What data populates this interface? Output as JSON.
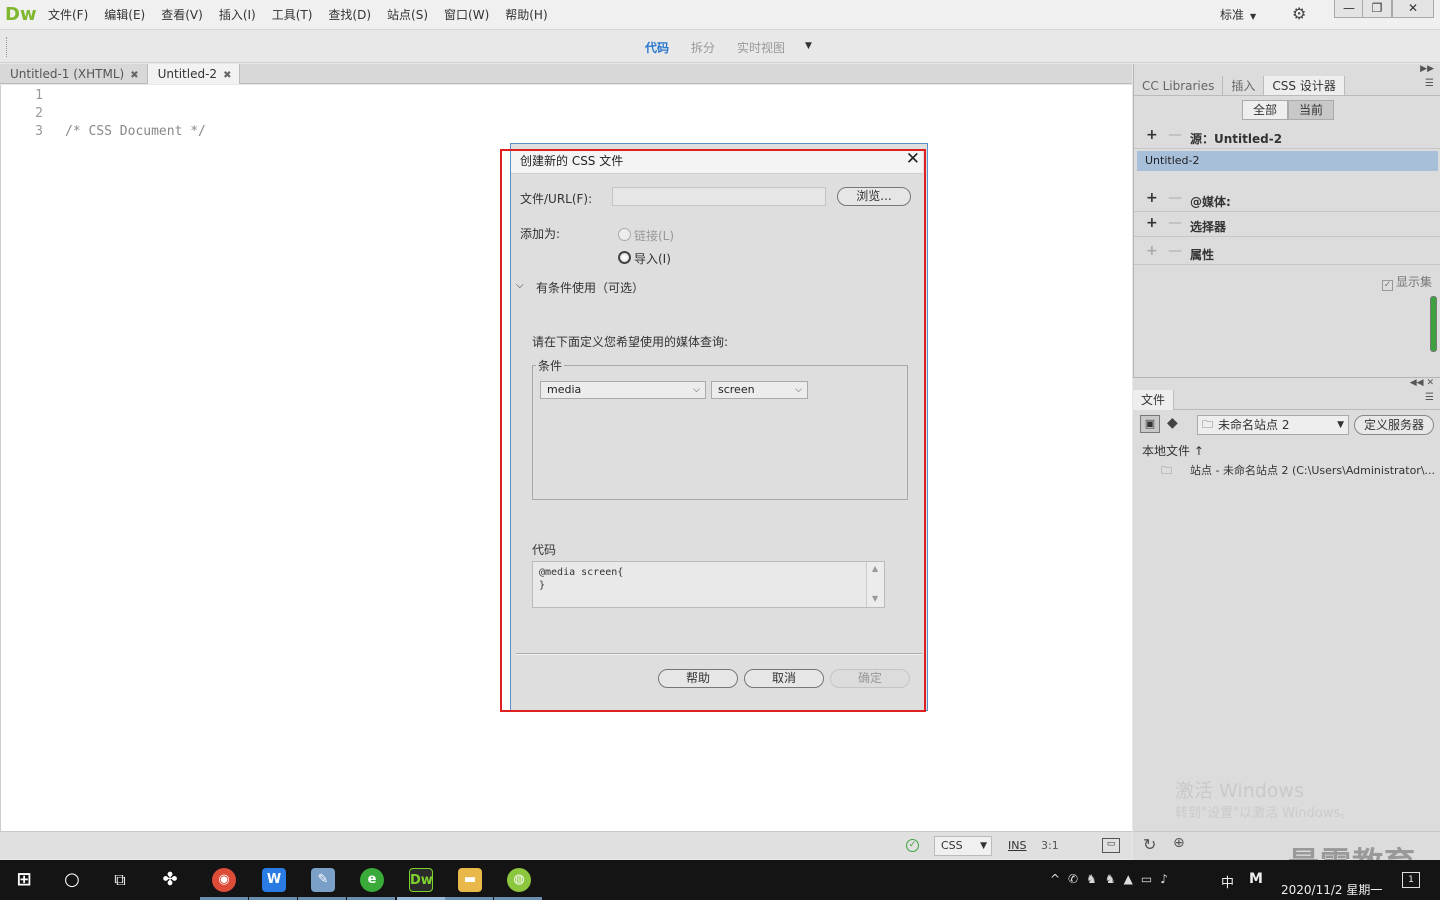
{
  "app": {
    "logo": "Dw",
    "menu": [
      "文件(F)",
      "编辑(E)",
      "查看(V)",
      "插入(I)",
      "工具(T)",
      "查找(D)",
      "站点(S)",
      "窗口(W)",
      "帮助(H)"
    ],
    "workspace": "标准",
    "window_controls": [
      "—",
      "❐",
      "✕"
    ]
  },
  "toolbar": {
    "view_tabs": [
      "代码",
      "拆分",
      "实时视图"
    ],
    "active_view": "代码"
  },
  "doc_tabs": [
    {
      "label": "Untitled-1 (XHTML)",
      "active": false
    },
    {
      "label": "Untitled-2",
      "active": true
    }
  ],
  "editor": {
    "line_numbers": [
      "1",
      "2",
      "3"
    ],
    "lines": [
      "/* CSS Document */",
      "",
      ""
    ]
  },
  "status": {
    "language": "CSS",
    "mode": "INS",
    "position": "3:1"
  },
  "css_panel": {
    "tabs": [
      "CC Libraries",
      "插入",
      "CSS 设计器"
    ],
    "active_tab": "CSS 设计器",
    "toggle": [
      "全部",
      "当前"
    ],
    "active_toggle": "当前",
    "source_label": "源：Untitled-2",
    "source_item": "Untitled-2",
    "media_label": "@媒体:",
    "selectors_label": "选择器",
    "properties_label": "属性",
    "show_set": "显示集"
  },
  "files_panel": {
    "tab": "文件",
    "site": "未命名站点 2",
    "define_server": "定义服务器",
    "local_files": "本地文件",
    "site_row": "站点 - 未命名站点 2 (C:\\Users\\Administrator\\..."
  },
  "watermark": {
    "line1": "激活 Windows",
    "line2": "转到\"设置\"以激活 Windows。",
    "brand": "最需教育"
  },
  "dialog": {
    "title": "创建新的 CSS 文件",
    "file_label": "文件/URL(F):",
    "file_value": "",
    "browse": "浏览...",
    "add_as": "添加为:",
    "radio_link": "链接(L)",
    "radio_import": "导入(I)",
    "selected_radio": "import",
    "conditional": "有条件使用（可选）",
    "media_query_prompt": "请在下面定义您希望使用的媒体查询:",
    "conditions_legend": "条件",
    "condition_1": "media",
    "condition_2": "screen",
    "code_label": "代码",
    "code": "@media screen{\n}",
    "help": "帮助",
    "cancel": "取消",
    "ok": "确定"
  },
  "taskbar": {
    "ime": "中",
    "m": "M",
    "date": "2020/11/2 星期一",
    "notifications": "1"
  }
}
